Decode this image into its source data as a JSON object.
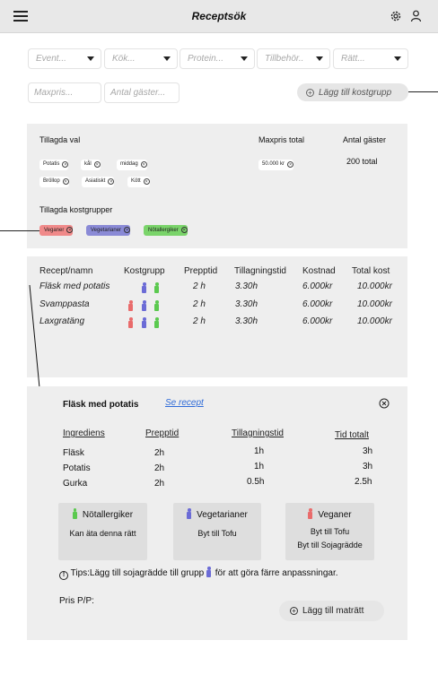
{
  "header": {
    "title": "Receptsök"
  },
  "filters": {
    "dropdowns": [
      "Event...",
      "Kök...",
      "Protein...",
      "Tillbehör..",
      "Rätt..."
    ],
    "max_price_placeholder": "Maxpris...",
    "guests_placeholder": "Antal gäster...",
    "add_group_button": "Lägg till kostgrupp"
  },
  "selection": {
    "title": "Tillagda val",
    "max_price_title": "Maxpris total",
    "guests_title": "Antal gäster",
    "chips": [
      "Potatis",
      "kål",
      "middag",
      "Bröllop",
      "Asiatiskt",
      "Kött"
    ],
    "max_price_chip": "50.000 kr",
    "guests_value": "200 total",
    "groups_title": "Tillagda kostgrupper",
    "groups": [
      {
        "label": "Veganer",
        "color": "#f08a8a"
      },
      {
        "label": "Vegetarianer",
        "color": "#8a8ad6"
      },
      {
        "label": "Nötallergiker",
        "color": "#7ad46a"
      }
    ]
  },
  "recipes": {
    "headers": [
      "Recept/namn",
      "Kostgrupp",
      "Prepptid",
      "Tillagningstid",
      "Kostnad",
      "Total kost"
    ],
    "rows": [
      {
        "name": "Fläsk med potatis",
        "groups": [
          "vegetarian",
          "nut"
        ],
        "prep": "2 h",
        "cook": "3.30h",
        "cost": "6.000kr",
        "total": "10.000kr"
      },
      {
        "name": "Svamppasta",
        "groups": [
          "vegan",
          "vegetarian",
          "nut"
        ],
        "prep": "2 h",
        "cook": "3.30h",
        "cost": "6.000kr",
        "total": "10.000kr"
      },
      {
        "name": "Laxgratäng",
        "groups": [
          "vegan",
          "vegetarian",
          "nut"
        ],
        "prep": "2 h",
        "cook": "3.30h",
        "cost": "6.000kr",
        "total": "10.000kr"
      }
    ]
  },
  "detail": {
    "title": "Fläsk med potatis",
    "see_recipe": "Se recept",
    "headers": [
      "Ingrediens",
      "Prepptid",
      "Tillagningstid",
      "Tid totalt"
    ],
    "rows": [
      {
        "ingredient": "Fläsk",
        "prep": "2h",
        "cook": "1h",
        "total": "3h"
      },
      {
        "ingredient": "Potatis",
        "prep": "2h",
        "cook": "1h",
        "total": "3h"
      },
      {
        "ingredient": "Gurka",
        "prep": "2h",
        "cook": "0.5h",
        "total": "2.5h"
      }
    ],
    "cards": [
      {
        "title": "Nötallergiker",
        "line1": "Kan äta denna rätt",
        "line2": ""
      },
      {
        "title": "Vegetarianer",
        "line1": "Byt till Tofu",
        "line2": ""
      },
      {
        "title": "Veganer",
        "line1": "Byt till Tofu",
        "line2": "Byt till Sojagrädde"
      }
    ],
    "tip_start": "Tips:Lägg till sojagrädde till grupp",
    "tip_end": "för att göra färre anpassningar.",
    "price_label": "Pris P/P:",
    "add_dish_button": "Lägg till maträtt"
  },
  "colors": {
    "vegan": "#e96b6b",
    "vegetarian": "#6b6bd6",
    "nut": "#5bc94f",
    "link": "#2f6bd8"
  }
}
